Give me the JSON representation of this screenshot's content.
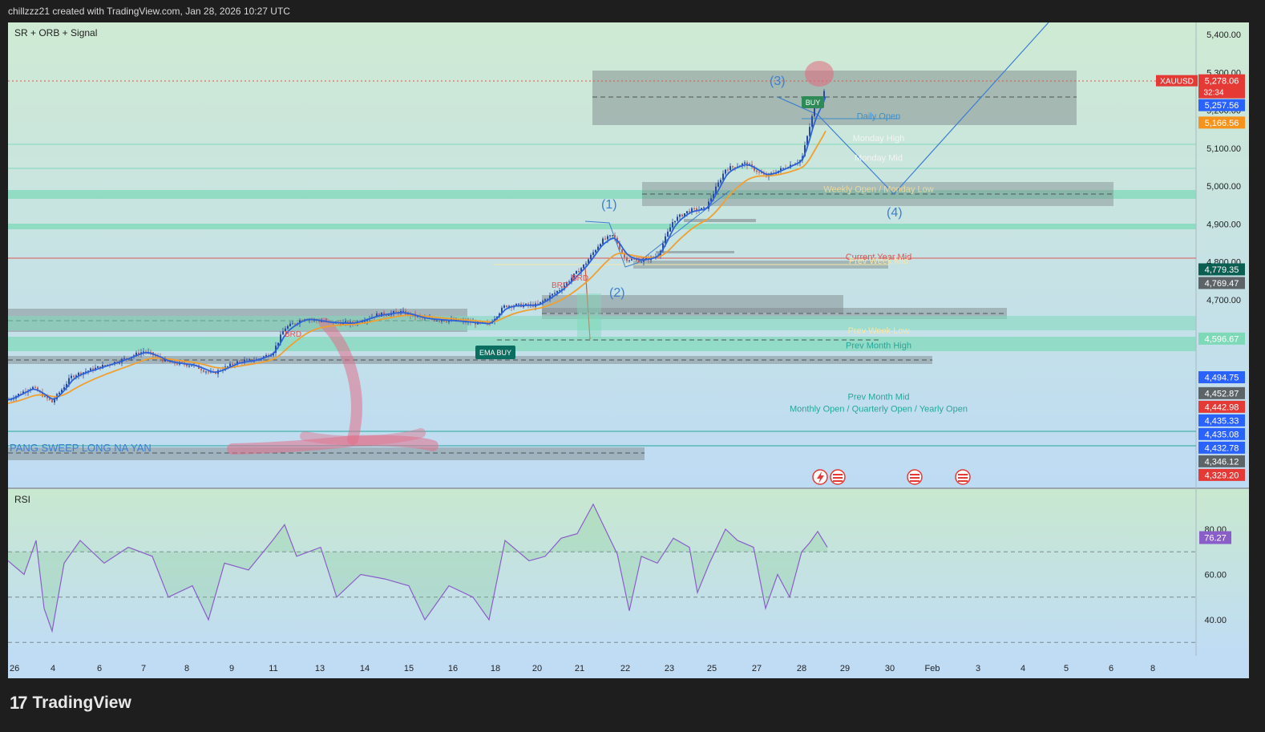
{
  "header": {
    "credit": "chillzzz21 created with TradingView.com, Jan 28, 2026 10:27 UTC"
  },
  "footer": {
    "brand": "TradingView"
  },
  "indicators": {
    "main_label": "SR + ORB + Signal",
    "rsi_label": "RSI"
  },
  "colors": {
    "price_panel_top": "#cde9d2",
    "price_panel_bottom": "#c0dcf4",
    "ema_fast": "#2f63d8",
    "ema_slow": "#f0a030",
    "zone_green": "#7dd9b8",
    "zone_gray": "#7f8a8c",
    "rsi_line": "#8a5ec8",
    "current_year_mid": "#e05555",
    "wave_line": "#3d7fcf"
  },
  "chart_data": [
    {
      "type": "candlestick",
      "symbol": "XAUUSD",
      "y_axis": {
        "min": 4290,
        "max": 5420,
        "ticks": [
          4700,
          4800,
          4900,
          5000,
          5100,
          5200,
          5300,
          5400
        ],
        "tick_labels": [
          "4,700.00",
          "4,800.00",
          "4,900.00",
          "5,000.00",
          "5,100.00",
          "5,200.00",
          "5,300.00",
          "5,400.00"
        ]
      },
      "x_axis": {
        "tick_labels": [
          "26",
          "4",
          "6",
          "7",
          "8",
          "9",
          "11",
          "13",
          "14",
          "15",
          "16",
          "18",
          "20",
          "21",
          "22",
          "23",
          "25",
          "27",
          "28",
          "29",
          "30",
          "Feb",
          "3",
          "4",
          "5",
          "6",
          "8"
        ]
      },
      "last_price": {
        "label": "XAUUSD",
        "value": 5278.06,
        "text": "5,278.06",
        "countdown": "32:34"
      },
      "price_tags": [
        {
          "value": 5257.56,
          "text": "5,257.56",
          "color": "#2962ff"
        },
        {
          "value": 5166.56,
          "text": "5,166.56",
          "color": "#f7931a"
        },
        {
          "value": 4779.35,
          "text": "4,779.35",
          "color": "#0b5e52"
        },
        {
          "value": 4769.47,
          "text": "4,769.47",
          "color": "#5d6468"
        },
        {
          "value": 4596.67,
          "text": "4,596.67",
          "color": "#7dd9b8"
        },
        {
          "value": 4494.75,
          "text": "4,494.75",
          "color": "#2962ff"
        },
        {
          "value": 4452.87,
          "text": "4,452.87",
          "color": "#5d6468"
        },
        {
          "value": 4442.98,
          "text": "4,442.98",
          "color": "#e53935"
        },
        {
          "value": 4435.33,
          "text": "4,435.33",
          "color": "#2962ff"
        },
        {
          "value": 4435.08,
          "text": "4,435.08",
          "color": "#2962ff"
        },
        {
          "value": 4432.78,
          "text": "4,432.78",
          "color": "#2962ff"
        },
        {
          "value": 4346.12,
          "text": "4,346.12",
          "color": "#5d6468"
        },
        {
          "value": 4329.2,
          "text": "4,329.20",
          "color": "#e53935"
        }
      ],
      "level_labels": [
        {
          "text": "Daily Open",
          "value": 5185,
          "color": "#3d8fc8"
        },
        {
          "text": "Monday High",
          "value": 5127,
          "color": "#f4f4f4"
        },
        {
          "text": "Monday Mid",
          "value": 5075,
          "color": "#f4f4f4"
        },
        {
          "text": "Weekly Open / Monday Low",
          "value": 4993,
          "color": "#e8d9a0"
        },
        {
          "text": "Current Year Mid",
          "value": 4814,
          "color": "#e05555"
        },
        {
          "text": "Prev Week Mid",
          "value": 4804,
          "color": "#f5e6a8"
        },
        {
          "text": "Prev Week Low",
          "value": 4620,
          "color": "#f5e6a8"
        },
        {
          "text": "Prev Month High",
          "value": 4580,
          "color": "#26a69a"
        },
        {
          "text": "Prev Month Mid",
          "value": 4445,
          "color": "#26a69a"
        },
        {
          "text": "Monthly Open / Quarterly Open / Yearly Open",
          "value": 4413,
          "color": "#26a69a"
        }
      ],
      "wave_labels": [
        "(1)",
        "(2)",
        "(3)",
        "(4)"
      ],
      "signals": [
        "BUY",
        "EMA BUY",
        "BRD",
        "BRD",
        "BRD"
      ],
      "annotations": [
        "PANG SWEEP LONG NA YAN"
      ],
      "series": [
        {
          "name": "price",
          "points": [
            [
              0,
              4436
            ],
            [
              30,
              4470
            ],
            [
              55,
              4430
            ],
            [
              80,
              4500
            ],
            [
              110,
              4520
            ],
            [
              140,
              4540
            ],
            [
              170,
              4565
            ],
            [
              200,
              4535
            ],
            [
              230,
              4528
            ],
            [
              255,
              4505
            ],
            [
              285,
              4535
            ],
            [
              310,
              4542
            ],
            [
              330,
              4560
            ],
            [
              345,
              4625
            ],
            [
              370,
              4652
            ],
            [
              400,
              4640
            ],
            [
              430,
              4638
            ],
            [
              460,
              4660
            ],
            [
              490,
              4668
            ],
            [
              520,
              4650
            ],
            [
              560,
              4644
            ],
            [
              600,
              4636
            ],
            [
              620,
              4685
            ],
            [
              660,
              4686
            ],
            [
              690,
              4730
            ],
            [
              720,
              4795
            ],
            [
              740,
              4855
            ],
            [
              755,
              4870
            ],
            [
              770,
              4808
            ],
            [
              790,
              4803
            ],
            [
              810,
              4816
            ],
            [
              830,
              4910
            ],
            [
              850,
              4936
            ],
            [
              870,
              4940
            ],
            [
              895,
              5045
            ],
            [
              920,
              5060
            ],
            [
              945,
              5025
            ],
            [
              970,
              5050
            ],
            [
              990,
              5070
            ],
            [
              1005,
              5200
            ],
            [
              1015,
              5230
            ],
            [
              1020,
              5262
            ]
          ]
        }
      ]
    },
    {
      "type": "line",
      "name": "RSI",
      "y_axis": {
        "min": 28,
        "max": 92,
        "ticks": [
          40,
          60,
          80
        ],
        "tick_labels": [
          "40.00",
          "60.00",
          "80.00"
        ]
      },
      "last_value": {
        "value": 76.27,
        "text": "76.27"
      },
      "points": [
        [
          0,
          66
        ],
        [
          20,
          60
        ],
        [
          35,
          75
        ],
        [
          45,
          45
        ],
        [
          55,
          35
        ],
        [
          70,
          65
        ],
        [
          90,
          75
        ],
        [
          120,
          65
        ],
        [
          150,
          72
        ],
        [
          180,
          68
        ],
        [
          200,
          50
        ],
        [
          230,
          55
        ],
        [
          250,
          40
        ],
        [
          270,
          65
        ],
        [
          300,
          62
        ],
        [
          330,
          75
        ],
        [
          345,
          82
        ],
        [
          360,
          68
        ],
        [
          390,
          72
        ],
        [
          410,
          50
        ],
        [
          440,
          60
        ],
        [
          470,
          58
        ],
        [
          500,
          55
        ],
        [
          520,
          40
        ],
        [
          550,
          55
        ],
        [
          580,
          50
        ],
        [
          600,
          40
        ],
        [
          620,
          75
        ],
        [
          650,
          66
        ],
        [
          670,
          68
        ],
        [
          690,
          76
        ],
        [
          710,
          78
        ],
        [
          730,
          91
        ],
        [
          745,
          80
        ],
        [
          760,
          69
        ],
        [
          775,
          44
        ],
        [
          790,
          68
        ],
        [
          810,
          65
        ],
        [
          830,
          76
        ],
        [
          850,
          72
        ],
        [
          860,
          52
        ],
        [
          875,
          65
        ],
        [
          895,
          80
        ],
        [
          910,
          75
        ],
        [
          930,
          72
        ],
        [
          945,
          45
        ],
        [
          960,
          60
        ],
        [
          975,
          50
        ],
        [
          990,
          70
        ],
        [
          1000,
          74
        ],
        [
          1010,
          79
        ],
        [
          1022,
          72
        ]
      ]
    }
  ]
}
